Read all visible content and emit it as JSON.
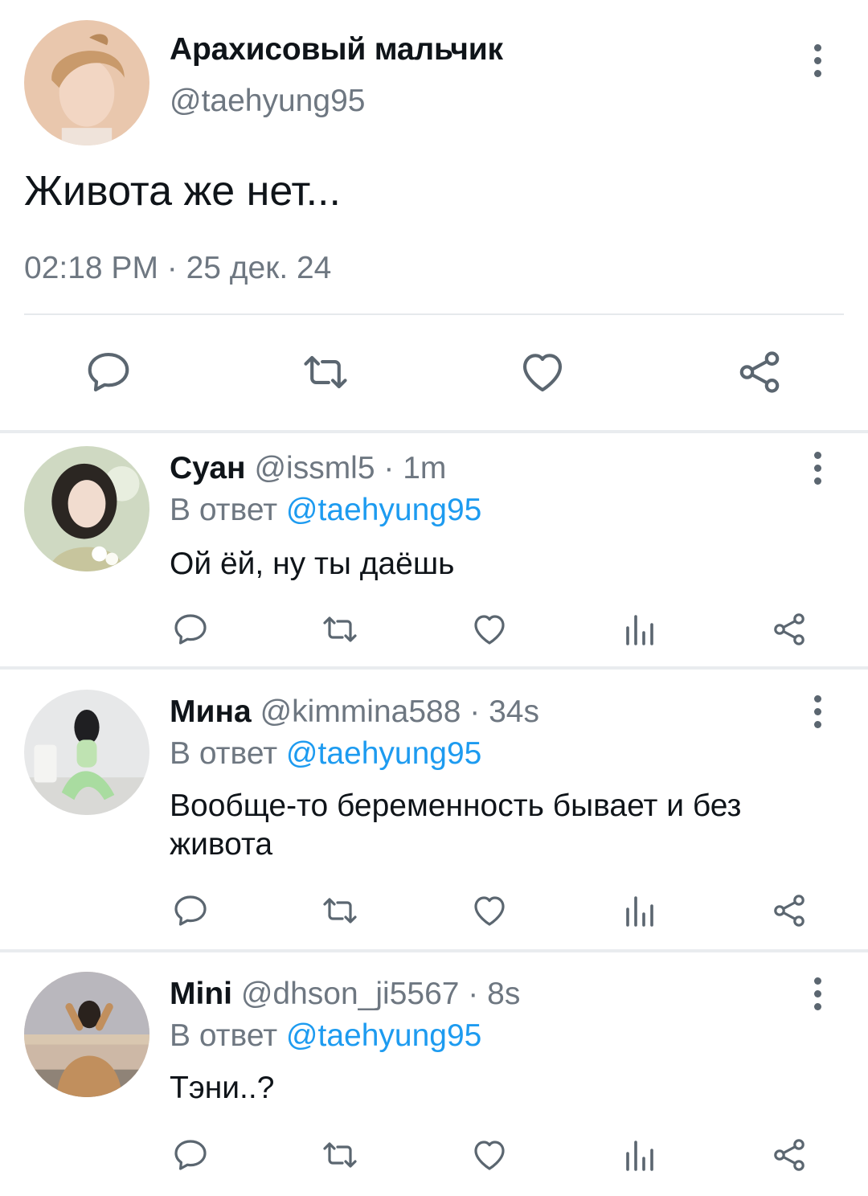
{
  "main_tweet": {
    "name": "Арахисовый мальчик",
    "handle": "@taehyung95",
    "text": "Живота же нет...",
    "timestamp": "02:18 PM · 25 дек. 24",
    "actions": [
      "reply-icon",
      "retweet-icon",
      "like-icon",
      "share-icon"
    ]
  },
  "replies": [
    {
      "name": "Суан",
      "handle": "@issml5",
      "time": " · 1m",
      "in_reply_prefix": "В ответ ",
      "in_reply_to": "@taehyung95",
      "text": "Ой ёй, ну ты даёшь"
    },
    {
      "name": "Мина",
      "handle": "@kimmina588",
      "time": " · 34s",
      "in_reply_prefix": "В ответ ",
      "in_reply_to": "@taehyung95",
      "text": "Вообще-то беременность бывает и без живота"
    },
    {
      "name": "Mini",
      "handle": "@dhson_ji5567",
      "time": " · 8s",
      "in_reply_prefix": "В ответ ",
      "in_reply_to": "@taehyung95",
      "text": "Тэни..?"
    }
  ],
  "reply_actions": [
    "reply-icon",
    "retweet-icon",
    "like-icon",
    "views-icon",
    "share-icon"
  ],
  "colors": {
    "text": "#0f1419",
    "secondary": "#6e7781",
    "mention": "#1d9bf0",
    "icon": "#5b6670",
    "divider": "#e9ecef"
  }
}
